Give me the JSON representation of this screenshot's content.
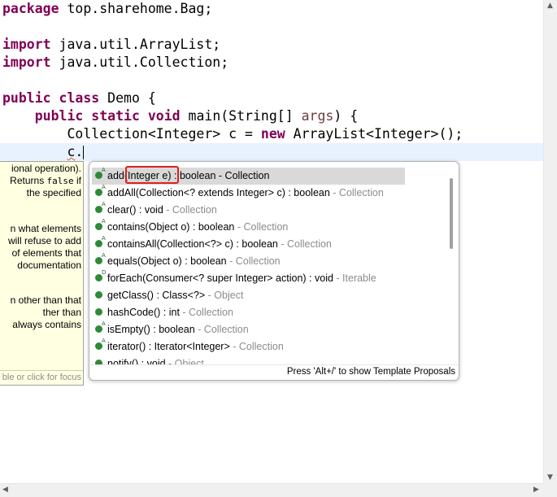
{
  "code": {
    "package_kw": "package",
    "package_name": " top.sharehome.Bag;",
    "import_kw": "import",
    "import1": " java.util.ArrayList;",
    "import2": " java.util.Collection;",
    "public_kw": "public",
    "class_kw": " class",
    "class_name": " Demo {",
    "static_kw": " static",
    "void_kw": " void",
    "main_sig": " main(String[] ",
    "args": "args",
    "main_end": ") {",
    "decl_start": "Collection<Integer> c = ",
    "new_kw": "new",
    "decl_end": " ArrayList<Integer>();",
    "current_var": "c",
    "current_dot": "."
  },
  "javadoc": {
    "lines": [
      "ional operation).",
      "Returns false if",
      "the specified",
      "",
      "n what elements",
      "will refuse to add",
      "of elements that",
      "documentation",
      "",
      "n other than that",
      "ther than",
      "always contains"
    ],
    "footer": "ble or click for focus"
  },
  "completion": {
    "items": [
      {
        "name": "add(Integer e)",
        "ret": " : boolean",
        "qual": " - Collection",
        "sup": "A"
      },
      {
        "name": "addAll(Collection<? extends Integer> c)",
        "ret": " : boolean",
        "qual": " - Collection",
        "sup": "A"
      },
      {
        "name": "clear()",
        "ret": " : void",
        "qual": " - Collection",
        "sup": "A"
      },
      {
        "name": "contains(Object o)",
        "ret": " : boolean",
        "qual": " - Collection",
        "sup": "A"
      },
      {
        "name": "containsAll(Collection<?> c)",
        "ret": " : boolean",
        "qual": " - Collection",
        "sup": "A"
      },
      {
        "name": "equals(Object o)",
        "ret": " : boolean",
        "qual": " - Collection",
        "sup": "A"
      },
      {
        "name": "forEach(Consumer<? super Integer> action)",
        "ret": " : void",
        "qual": " - Iterable",
        "sup": "D"
      },
      {
        "name": "getClass()",
        "ret": " : Class<?>",
        "qual": " - Object",
        "sup": ""
      },
      {
        "name": "hashCode()",
        "ret": " : int",
        "qual": " - Collection",
        "sup": ""
      },
      {
        "name": "isEmpty()",
        "ret": " : boolean",
        "qual": " - Collection",
        "sup": "A"
      },
      {
        "name": "iterator()",
        "ret": " : Iterator<Integer>",
        "qual": " - Collection",
        "sup": "A"
      },
      {
        "name": "notify()",
        "ret": " : void",
        "qual": " - Object",
        "sup": ""
      }
    ],
    "selected_index": 0,
    "footer": "Press 'Alt+/' to show Template Proposals"
  }
}
